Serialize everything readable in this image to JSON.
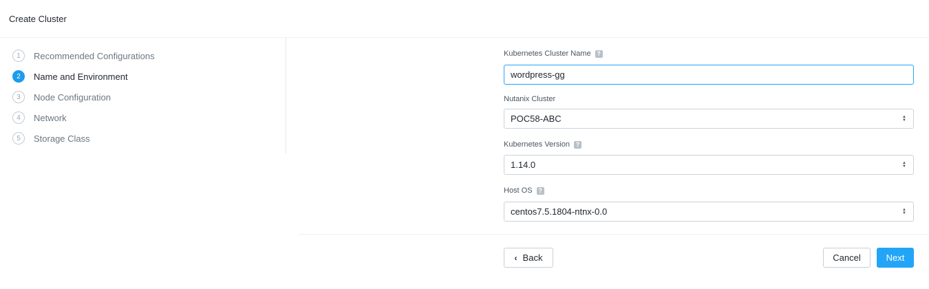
{
  "header": {
    "title": "Create Cluster"
  },
  "steps": [
    {
      "num": "1",
      "label": "Recommended Configurations"
    },
    {
      "num": "2",
      "label": "Name and Environment"
    },
    {
      "num": "3",
      "label": "Node Configuration"
    },
    {
      "num": "4",
      "label": "Network"
    },
    {
      "num": "5",
      "label": "Storage Class"
    }
  ],
  "active_step": 2,
  "form": {
    "cluster_name": {
      "label": "Kubernetes Cluster Name",
      "value": "wordpress-gg"
    },
    "nutanix_cluster": {
      "label": "Nutanix Cluster",
      "value": "POC58-ABC"
    },
    "k8s_version": {
      "label": "Kubernetes Version",
      "value": "1.14.0"
    },
    "host_os": {
      "label": "Host OS",
      "value": "centos7.5.1804-ntnx-0.0"
    },
    "help_glyph": "?"
  },
  "footer": {
    "back": "Back",
    "cancel": "Cancel",
    "next": "Next"
  },
  "colors": {
    "accent": "#22a5f7",
    "active_step": "#1b9ced"
  }
}
